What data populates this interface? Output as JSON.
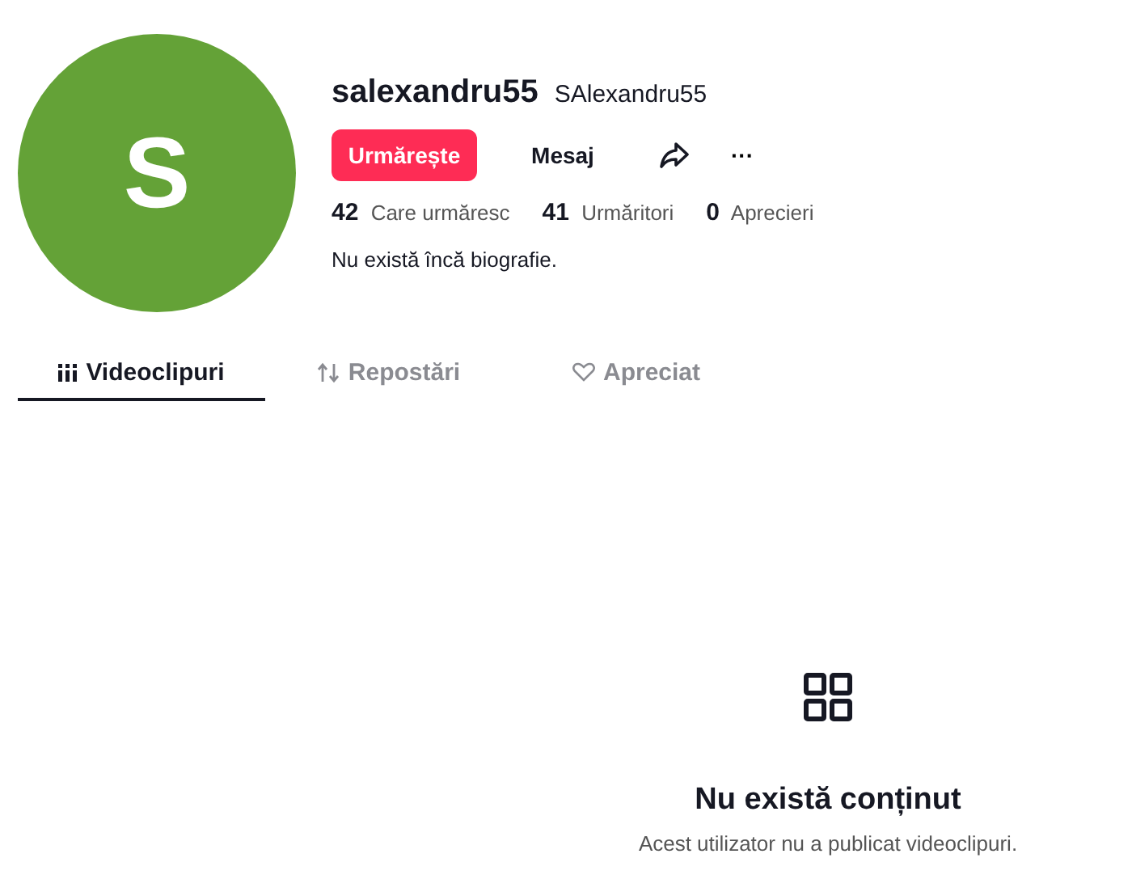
{
  "profile": {
    "avatar_letter": "S",
    "username": "salexandru55",
    "display_name": "SAlexandru55",
    "bio": "Nu există încă biografie."
  },
  "buttons": [
    {
      "kind": "follow",
      "label": "Urmărește"
    },
    {
      "kind": "message",
      "label": "Mesaj"
    },
    {
      "kind": "share"
    },
    {
      "kind": "more",
      "label": "···"
    }
  ],
  "stats": [
    {
      "count": "42",
      "name": "Care urmăresc"
    },
    {
      "count": "41",
      "name": "Urmăritori"
    },
    {
      "count": "0",
      "name": "Aprecieri"
    }
  ],
  "tabs": [
    {
      "kind": "videos",
      "label": "Videoclipuri",
      "selected": true
    },
    {
      "kind": "reposts",
      "label": "Repostări",
      "selected": false
    },
    {
      "kind": "liked",
      "label": "Apreciat",
      "selected": false
    }
  ],
  "empty_state": {
    "title": "Nu există conținut",
    "message": "Acest utilizator nu a publicat videoclipuri."
  }
}
